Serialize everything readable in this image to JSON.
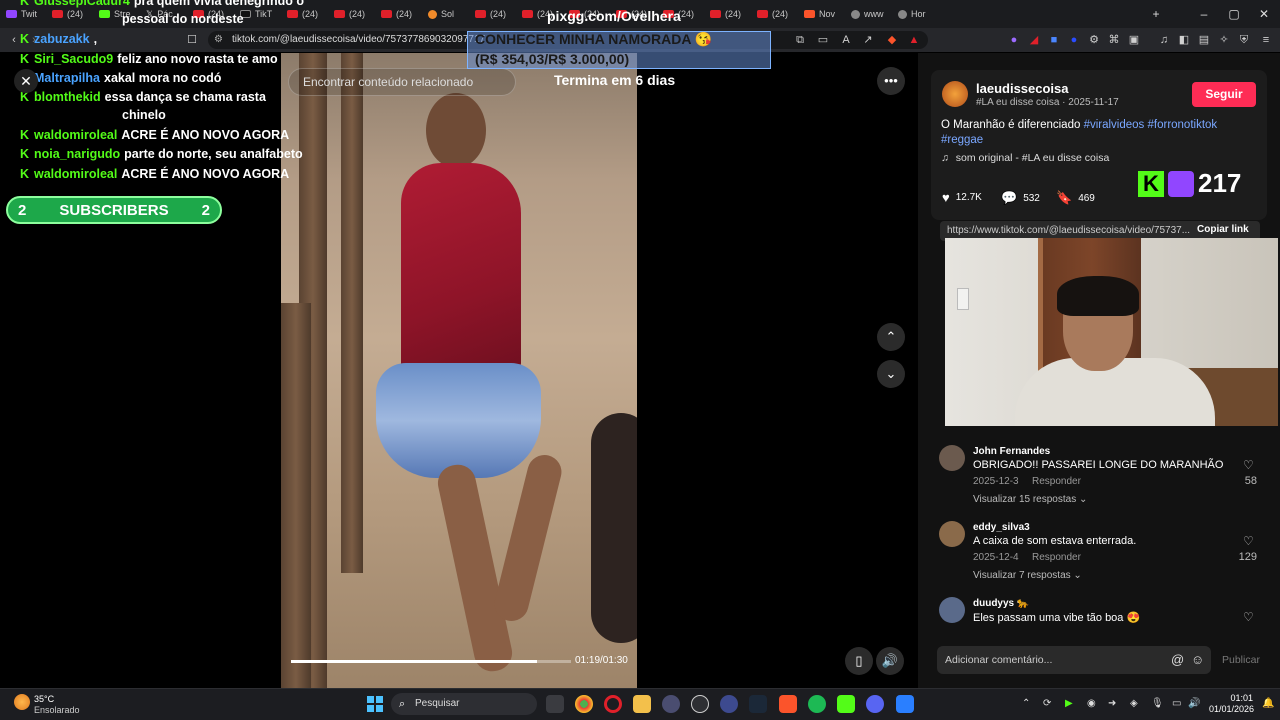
{
  "tabs": [
    {
      "label": "Twit",
      "icon": "twitch-icon"
    },
    {
      "label": "(24)",
      "icon": "youtube-icon"
    },
    {
      "label": "Stre",
      "icon": "kick-icon"
    },
    {
      "label": "Pác",
      "icon": "x-icon"
    },
    {
      "label": "(24)",
      "icon": "youtube-icon"
    },
    {
      "label": "TikT",
      "icon": "tiktok-icon"
    },
    {
      "label": "(24)",
      "icon": "youtube-icon"
    },
    {
      "label": "(24)",
      "icon": "youtube-icon"
    },
    {
      "label": "(24)",
      "icon": "youtube-icon"
    },
    {
      "label": "Sol",
      "icon": "shopee-icon"
    },
    {
      "label": "(24)",
      "icon": "youtube-icon"
    },
    {
      "label": "(24)",
      "icon": "youtube-icon"
    },
    {
      "label": "(24)",
      "icon": "youtube-icon"
    },
    {
      "label": "(24)",
      "icon": "youtube-icon"
    },
    {
      "label": "(24)",
      "icon": "youtube-icon"
    },
    {
      "label": "(24)",
      "icon": "youtube-icon"
    },
    {
      "label": "(24)",
      "icon": "youtube-icon"
    },
    {
      "label": "Nov",
      "icon": "brave-icon"
    },
    {
      "label": "www",
      "icon": "globe-icon"
    },
    {
      "label": "Hor",
      "icon": "globe-icon"
    }
  ],
  "address": {
    "url": "tiktok.com/@laeudissecoisa/video/757377869032097717"
  },
  "chat": {
    "lines": [
      {
        "user": "GiusseplCadur4",
        "msg": "pra quem vivia denegrindo o",
        "blue": false
      },
      {
        "user": "",
        "msg": "pessoal do nordeste",
        "blue": false
      },
      {
        "user": "zabuzakk",
        "msg": ",",
        "blue": true
      },
      {
        "user": "Siri_Sacudo9",
        "msg": "feliz ano novo rasta te amo",
        "blue": false
      },
      {
        "user": "Maltrapilha",
        "msg": "xakal mora no codó",
        "blue": true
      },
      {
        "user": "blomthekid",
        "msg": "essa dança se chama rasta",
        "blue": false
      },
      {
        "user": "",
        "msg": "chinelo",
        "blue": false
      },
      {
        "user": "waldomiroleal",
        "msg": "ACRE É ANO NOVO AGORA",
        "blue": false
      },
      {
        "user": "noia_narigudo",
        "msg": "parte do norte, seu analfabeto",
        "blue": false
      },
      {
        "user": "waldomiroleal",
        "msg": "ACRE É ANO NOVO AGORA",
        "blue": false
      }
    ]
  },
  "subscribers": {
    "left": "2",
    "label": "SUBSCRIBERS",
    "right": "2"
  },
  "overlay": {
    "pixgg": "pixgg.com/Ovelhera",
    "goal_title": "CONHECER MINHA NAMORADA 😘",
    "goal_amount": "(R$ 354,03/R$ 3.000,00)",
    "goal_progress_fraction": 0.118,
    "termina": "Termina em 6 dias",
    "viewer_count": "217"
  },
  "video": {
    "find_related_placeholder": "Encontrar conteúdo relacionado",
    "timecode": "01:19/01:30",
    "progress_fraction": 0.88
  },
  "post": {
    "author": "laeudissecoisa",
    "author_sub": "#LA eu disse coisa · 2025-11-17",
    "follow": "Seguir",
    "desc_plain": "O Maranhão é diferenciado ",
    "desc_tags": [
      "#viralvideos",
      "#forronotiktok",
      "#reggae"
    ],
    "sound": "som original - #LA eu disse coisa",
    "likes": "12.7K",
    "comments": "532",
    "saves": "469",
    "link": "https://www.tiktok.com/@laeudissecoisa/video/75737...",
    "copy_link": "Copiar link"
  },
  "comments": [
    {
      "name": "John Fernandes",
      "text": "OBRIGADO!! PASSAREI LONGE DO MARANHÃO",
      "date": "2025-12-3",
      "reply": "Responder",
      "more": "Visualizar 15 respostas",
      "likes": "58",
      "color": "#6b5a4e"
    },
    {
      "name": "eddy_silva3",
      "text": "A caixa de som estava enterrada.",
      "date": "2025-12-4",
      "reply": "Responder",
      "more": "Visualizar 7 respostas",
      "likes": "129",
      "color": "#8a6a4a"
    },
    {
      "name": "duudyys 🐆",
      "text": "Eles passam uma vibe tão boa 😍",
      "date": "",
      "reply": "",
      "more": "",
      "likes": "",
      "color": "#5a6a8a"
    }
  ],
  "comment_input": {
    "placeholder": "Adicionar comentário...",
    "publish": "Publicar"
  },
  "taskbar": {
    "temp": "35°C",
    "weather": "Ensolarado",
    "search": "Pesquisar",
    "time": "01:01",
    "date": "01/01/2026"
  }
}
